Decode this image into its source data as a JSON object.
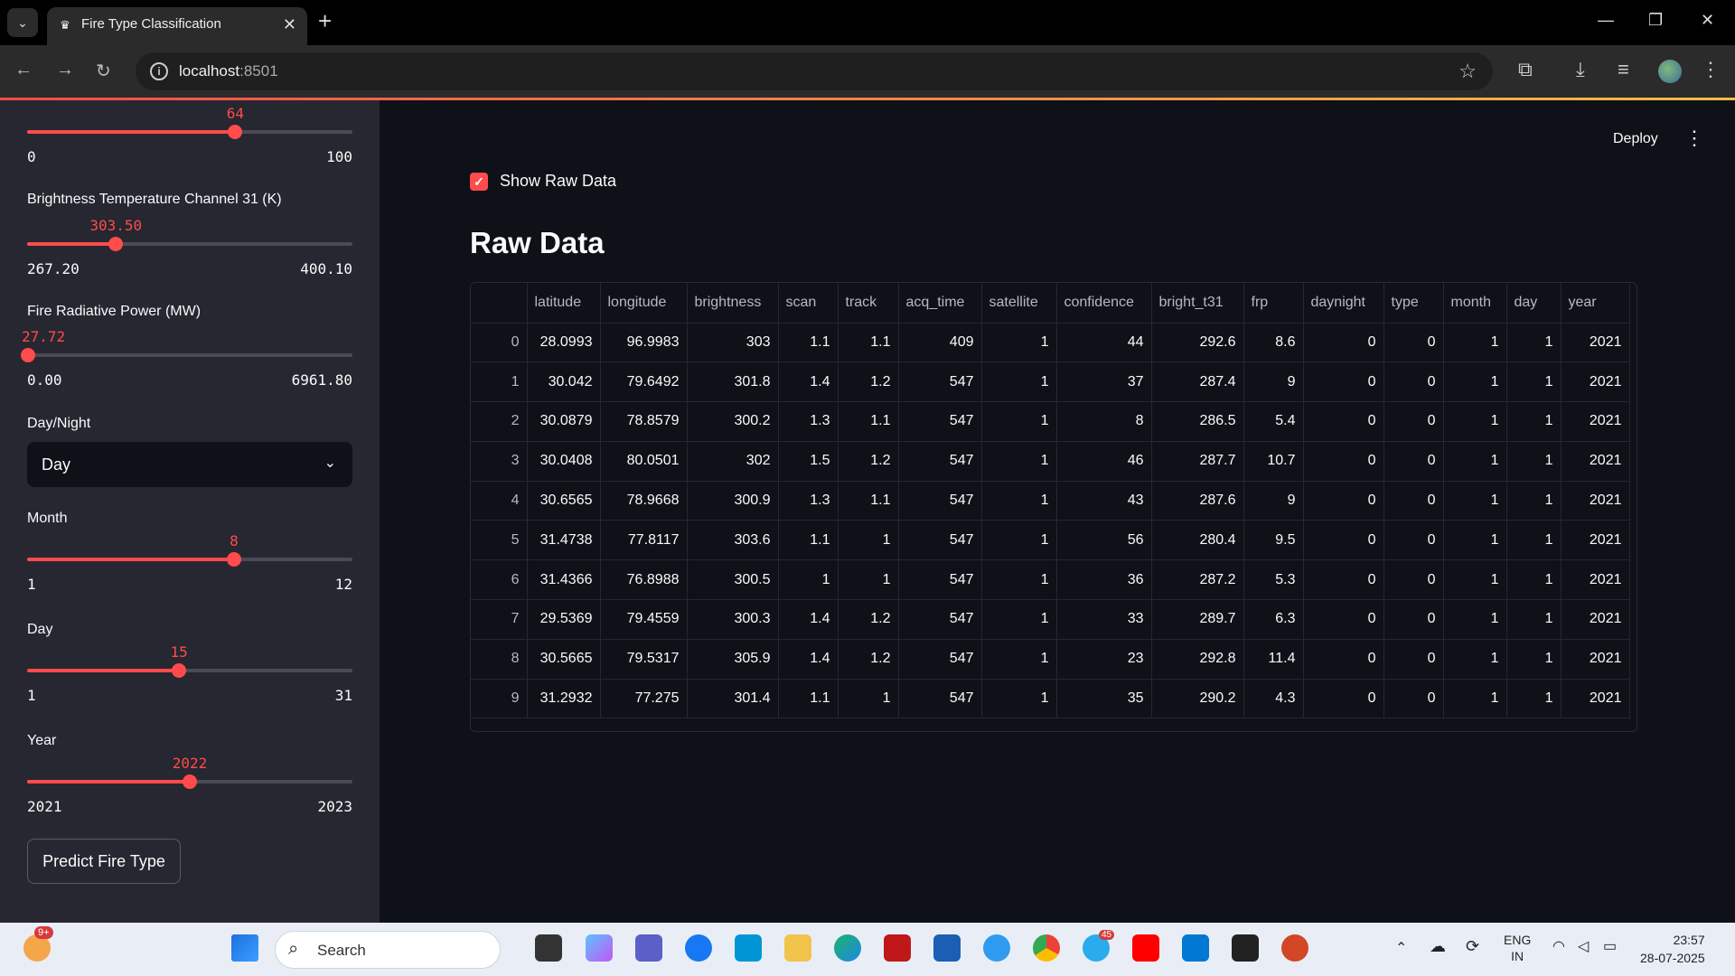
{
  "browser": {
    "tab_title": "Fire Type Classification",
    "url_host": "localhost",
    "url_port": ":8501"
  },
  "header": {
    "deploy_label": "Deploy"
  },
  "sidebar": {
    "top_slider": {
      "value": "64",
      "min": "0",
      "max": "100",
      "fraction": 0.64
    },
    "bright_t31": {
      "label": "Brightness Temperature Channel 31 (K)",
      "value": "303.50",
      "min": "267.20",
      "max": "400.10",
      "fraction": 0.273
    },
    "frp": {
      "label": "Fire Radiative Power (MW)",
      "value": "27.72",
      "min": "0.00",
      "max": "6961.80",
      "fraction": 0.004
    },
    "daynight": {
      "label": "Day/Night",
      "selected": "Day"
    },
    "month": {
      "label": "Month",
      "value": "8",
      "min": "1",
      "max": "12",
      "fraction": 0.636
    },
    "day": {
      "label": "Day",
      "value": "15",
      "min": "1",
      "max": "31",
      "fraction": 0.467
    },
    "year": {
      "label": "Year",
      "value": "2022",
      "min": "2021",
      "max": "2023",
      "fraction": 0.5
    },
    "predict_label": "Predict Fire Type"
  },
  "main": {
    "checkbox_label": "Show Raw Data",
    "checkbox_checked": true,
    "raw_title": "Raw Data",
    "columns": [
      "",
      "latitude",
      "longitude",
      "brightness",
      "scan",
      "track",
      "acq_time",
      "satellite",
      "confidence",
      "bright_t31",
      "frp",
      "daynight",
      "type",
      "month",
      "day",
      "year"
    ],
    "rows": [
      [
        "0",
        "28.0993",
        "96.9983",
        "303",
        "1.1",
        "1.1",
        "409",
        "1",
        "44",
        "292.6",
        "8.6",
        "0",
        "0",
        "1",
        "1",
        "2021"
      ],
      [
        "1",
        "30.042",
        "79.6492",
        "301.8",
        "1.4",
        "1.2",
        "547",
        "1",
        "37",
        "287.4",
        "9",
        "0",
        "0",
        "1",
        "1",
        "2021"
      ],
      [
        "2",
        "30.0879",
        "78.8579",
        "300.2",
        "1.3",
        "1.1",
        "547",
        "1",
        "8",
        "286.5",
        "5.4",
        "0",
        "0",
        "1",
        "1",
        "2021"
      ],
      [
        "3",
        "30.0408",
        "80.0501",
        "302",
        "1.5",
        "1.2",
        "547",
        "1",
        "46",
        "287.7",
        "10.7",
        "0",
        "0",
        "1",
        "1",
        "2021"
      ],
      [
        "4",
        "30.6565",
        "78.9668",
        "300.9",
        "1.3",
        "1.1",
        "547",
        "1",
        "43",
        "287.6",
        "9",
        "0",
        "0",
        "1",
        "1",
        "2021"
      ],
      [
        "5",
        "31.4738",
        "77.8117",
        "303.6",
        "1.1",
        "1",
        "547",
        "1",
        "56",
        "280.4",
        "9.5",
        "0",
        "0",
        "1",
        "1",
        "2021"
      ],
      [
        "6",
        "31.4366",
        "76.8988",
        "300.5",
        "1",
        "1",
        "547",
        "1",
        "36",
        "287.2",
        "5.3",
        "0",
        "0",
        "1",
        "1",
        "2021"
      ],
      [
        "7",
        "29.5369",
        "79.4559",
        "300.3",
        "1.4",
        "1.2",
        "547",
        "1",
        "33",
        "289.7",
        "6.3",
        "0",
        "0",
        "1",
        "1",
        "2021"
      ],
      [
        "8",
        "30.5665",
        "79.5317",
        "305.9",
        "1.4",
        "1.2",
        "547",
        "1",
        "23",
        "292.8",
        "11.4",
        "0",
        "0",
        "1",
        "1",
        "2021"
      ],
      [
        "9",
        "31.2932",
        "77.275",
        "301.4",
        "1.1",
        "1",
        "547",
        "1",
        "35",
        "290.2",
        "4.3",
        "0",
        "0",
        "1",
        "1",
        "2021"
      ]
    ]
  },
  "taskbar": {
    "search_label": "Search",
    "notif_badge": "9+",
    "telegram_badge": "45",
    "lang_line1": "ENG",
    "lang_line2": "IN",
    "time": "23:57",
    "date": "28-07-2025"
  },
  "colors": {
    "accent": "#ff4b4b",
    "background": "#0e1117",
    "sidebar": "#262730"
  }
}
